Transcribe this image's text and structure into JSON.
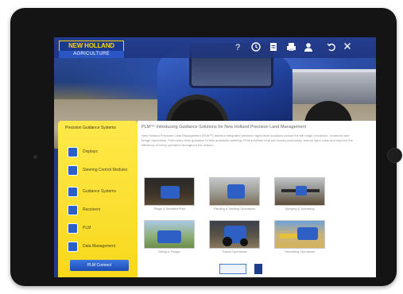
{
  "brand": {
    "name": "NEW HOLLAND",
    "subtitle": "AGRICULTURE"
  },
  "topbar_icons": [
    "help-icon",
    "clock-icon",
    "document-icon",
    "print-icon",
    "user-icon",
    "back-icon",
    "close-icon"
  ],
  "sidebar": {
    "title": "Precision Guidance Systems",
    "items": [
      {
        "label": "Displays",
        "icon": "display-icon"
      },
      {
        "label": "Steering Control Modules",
        "icon": "steering-icon"
      },
      {
        "label": "Guidance Systems",
        "icon": "guidance-icon"
      },
      {
        "label": "Receivers",
        "icon": "receiver-icon"
      },
      {
        "label": "PLM",
        "icon": "plm-icon"
      },
      {
        "label": "Data Management",
        "icon": "data-icon"
      }
    ],
    "button_label": "PLM Connect"
  },
  "content": {
    "title": "PLM™ Introducing Guidance Solutions for New Holland Precision Land Management",
    "paragraph": "New Holland Precision Land Management (PLM™) delivers integrated precision agriculture solutions across the full range of tractors, combines and forage harvesters. From entry level guidance to fully automatic steering, PLM solutions help you boost productivity, reduce input costs and improve the efficiency of every operation throughout the season.",
    "thumbnails": [
      {
        "caption": "Tillage & Seedbed Prep"
      },
      {
        "caption": "Planting & Seeding Operations"
      },
      {
        "caption": "Spraying & Spreading"
      },
      {
        "caption": "Baling & Forage"
      },
      {
        "caption": "Tractor Operations"
      },
      {
        "caption": "Harvesting Operations"
      }
    ],
    "logos": [
      "plm-logo",
      "nh-logo"
    ]
  },
  "colors": {
    "brand_blue": "#1b3a8e",
    "brand_yellow": "#ffd400",
    "sidebar_yellow": "#f8d81c",
    "icon_blue": "#2b60c8"
  }
}
